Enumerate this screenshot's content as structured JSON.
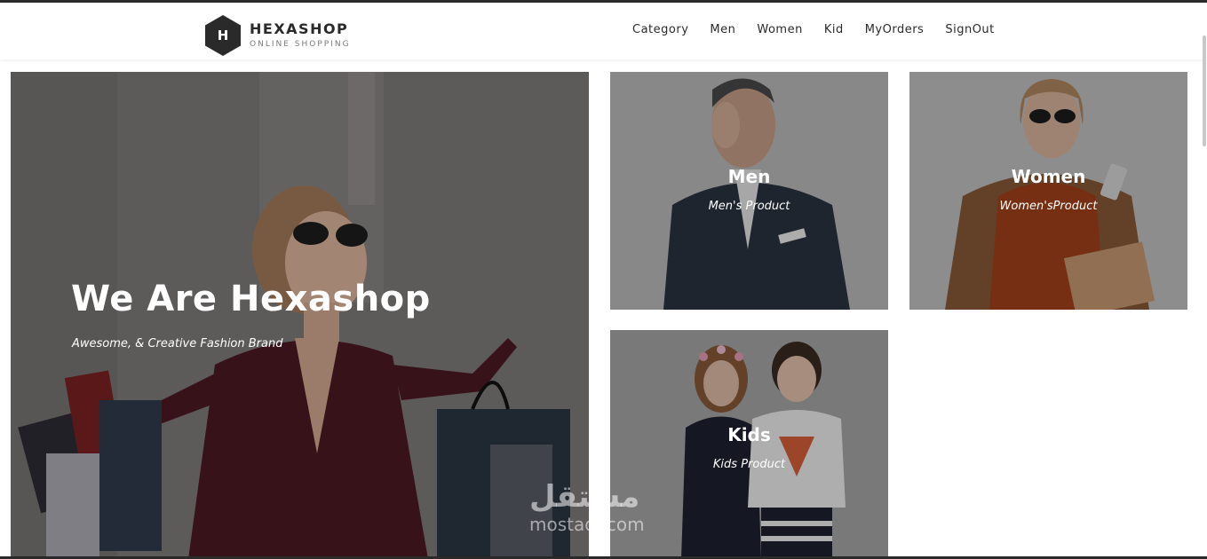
{
  "brand": {
    "logo_letter": "H",
    "name": "HEXASHOP",
    "tagline": "ONLINE SHOPPING"
  },
  "nav": {
    "items": [
      {
        "label": "Category"
      },
      {
        "label": "Men"
      },
      {
        "label": "Women"
      },
      {
        "label": "Kid"
      },
      {
        "label": "MyOrders"
      },
      {
        "label": "SignOut"
      }
    ]
  },
  "hero": {
    "title": "We Are Hexashop",
    "subtitle": "Awesome, & Creative Fashion Brand"
  },
  "categories": [
    {
      "title": "Men",
      "subtitle": "Men's Product"
    },
    {
      "title": "Women",
      "subtitle": "Women'sProduct"
    },
    {
      "title": "Kids",
      "subtitle": "Kids Product"
    }
  ],
  "watermark": {
    "arabic": "مستقل",
    "latin": "mostaql.com"
  },
  "colors": {
    "text_dark": "#2a2a2a",
    "overlay_text": "#ffffff"
  }
}
